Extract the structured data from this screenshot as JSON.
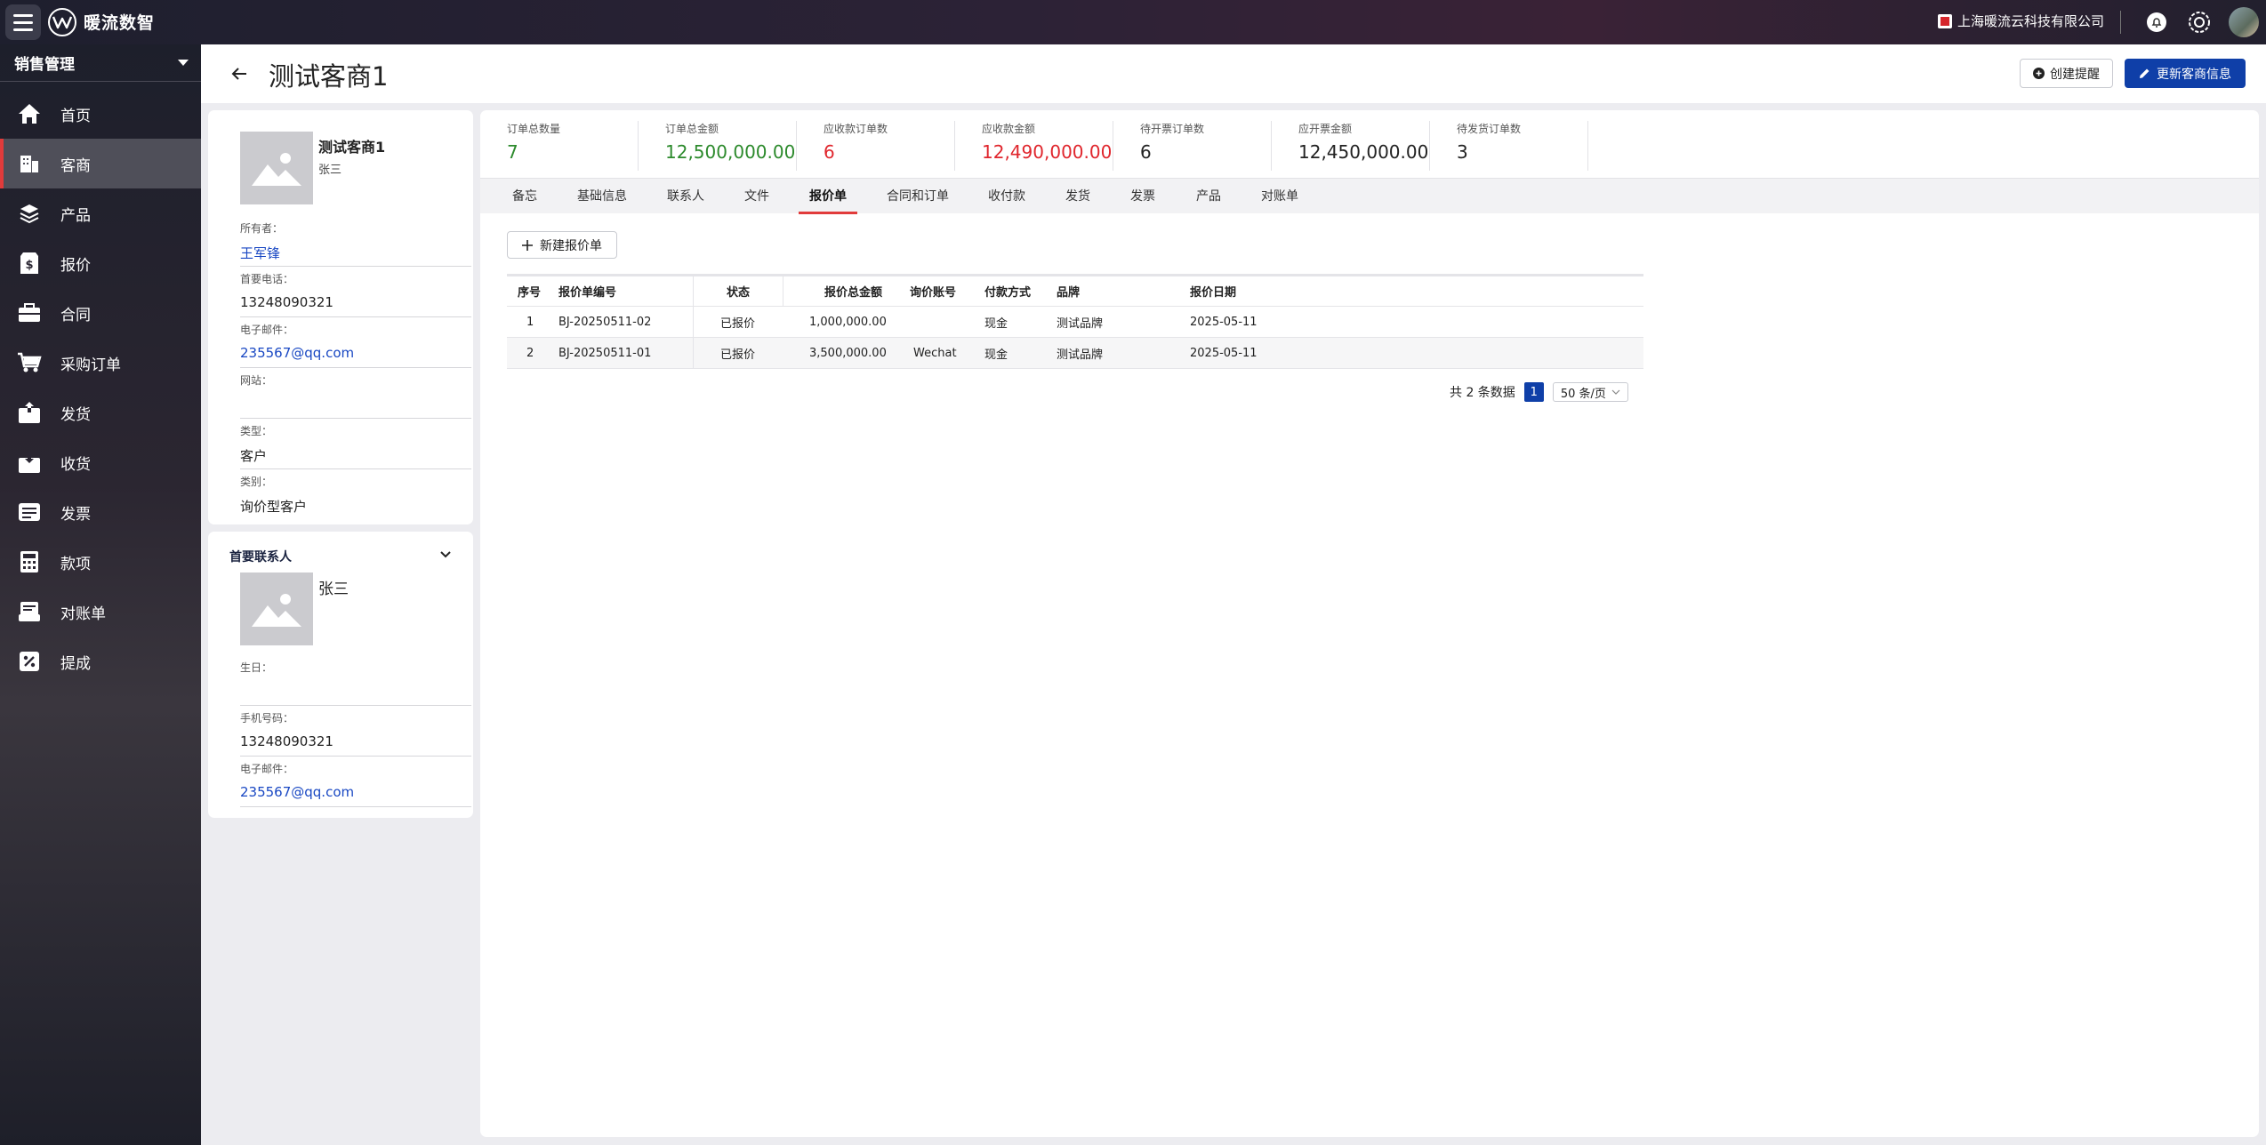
{
  "app": {
    "brand": "暖流数智",
    "company": "上海暖流云科技有限公司"
  },
  "sidebar": {
    "module": "销售管理",
    "items": [
      {
        "label": "首页",
        "icon": "home-icon"
      },
      {
        "label": "客商",
        "icon": "building-icon"
      },
      {
        "label": "产品",
        "icon": "layers-icon"
      },
      {
        "label": "报价",
        "icon": "price-tag-icon"
      },
      {
        "label": "合同",
        "icon": "briefcase-icon"
      },
      {
        "label": "采购订单",
        "icon": "cart-icon"
      },
      {
        "label": "发货",
        "icon": "box-out-icon"
      },
      {
        "label": "收货",
        "icon": "box-in-icon"
      },
      {
        "label": "发票",
        "icon": "invoice-icon"
      },
      {
        "label": "款项",
        "icon": "calculator-icon"
      },
      {
        "label": "对账单",
        "icon": "statement-icon"
      },
      {
        "label": "提成",
        "icon": "percent-icon"
      }
    ],
    "active_index": 1
  },
  "header": {
    "title": "测试客商1",
    "reminder_label": "创建提醒",
    "update_label": "更新客商信息"
  },
  "customer": {
    "name": "测试客商1",
    "contact": "张三",
    "fields": [
      {
        "label": "所有者：",
        "value": "王军锋",
        "link": true
      },
      {
        "label": "首要电话：",
        "value": "13248090321",
        "link": false
      },
      {
        "label": "电子邮件：",
        "value": "235567@qq.com",
        "link": true
      },
      {
        "label": "网站：",
        "value": "",
        "link": false
      },
      {
        "label": "类型：",
        "value": "客户",
        "link": false
      },
      {
        "label": "类别：",
        "value": "询价型客户",
        "link": false
      }
    ]
  },
  "primary_contact": {
    "title": "首要联系人",
    "name": "张三",
    "fields": [
      {
        "label": "生日：",
        "value": "",
        "link": false
      },
      {
        "label": "手机号码：",
        "value": "13248090321",
        "link": false
      },
      {
        "label": "电子邮件：",
        "value": "235567@qq.com",
        "link": true
      }
    ]
  },
  "stats": [
    {
      "label": "订单总数量",
      "value": "7",
      "color": "#2c8a2c"
    },
    {
      "label": "订单总金额",
      "value": "12,500,000.00",
      "color": "#2c8a2c"
    },
    {
      "label": "应收款订单数",
      "value": "6",
      "color": "#e0262d"
    },
    {
      "label": "应收款金额",
      "value": "12,490,000.00",
      "color": "#e0262d"
    },
    {
      "label": "待开票订单数",
      "value": "6",
      "color": "#222222"
    },
    {
      "label": "应开票金额",
      "value": "12,450,000.00",
      "color": "#222222"
    },
    {
      "label": "待发货订单数",
      "value": "3",
      "color": "#222222"
    }
  ],
  "tabs": [
    "备忘",
    "基础信息",
    "联系人",
    "文件",
    "报价单",
    "合同和订单",
    "收付款",
    "发货",
    "发票",
    "产品",
    "对账单"
  ],
  "active_tab": 4,
  "new_quote_label": "新建报价单",
  "table": {
    "columns": [
      "序号",
      "报价单编号",
      "状态",
      "报价总金额",
      "询价账号",
      "付款方式",
      "品牌",
      "报价日期"
    ],
    "rows": [
      [
        "1",
        "BJ-20250511-02",
        "已报价",
        "1,000,000.00",
        "",
        "现金",
        "测试品牌",
        "2025-05-11"
      ],
      [
        "2",
        "BJ-20250511-01",
        "已报价",
        "3,500,000.00",
        "Wechat",
        "现金",
        "测试品牌",
        "2025-05-11"
      ]
    ]
  },
  "pager": {
    "total": "共 2 条数据",
    "page": "1",
    "page_size": "50 条/页"
  }
}
